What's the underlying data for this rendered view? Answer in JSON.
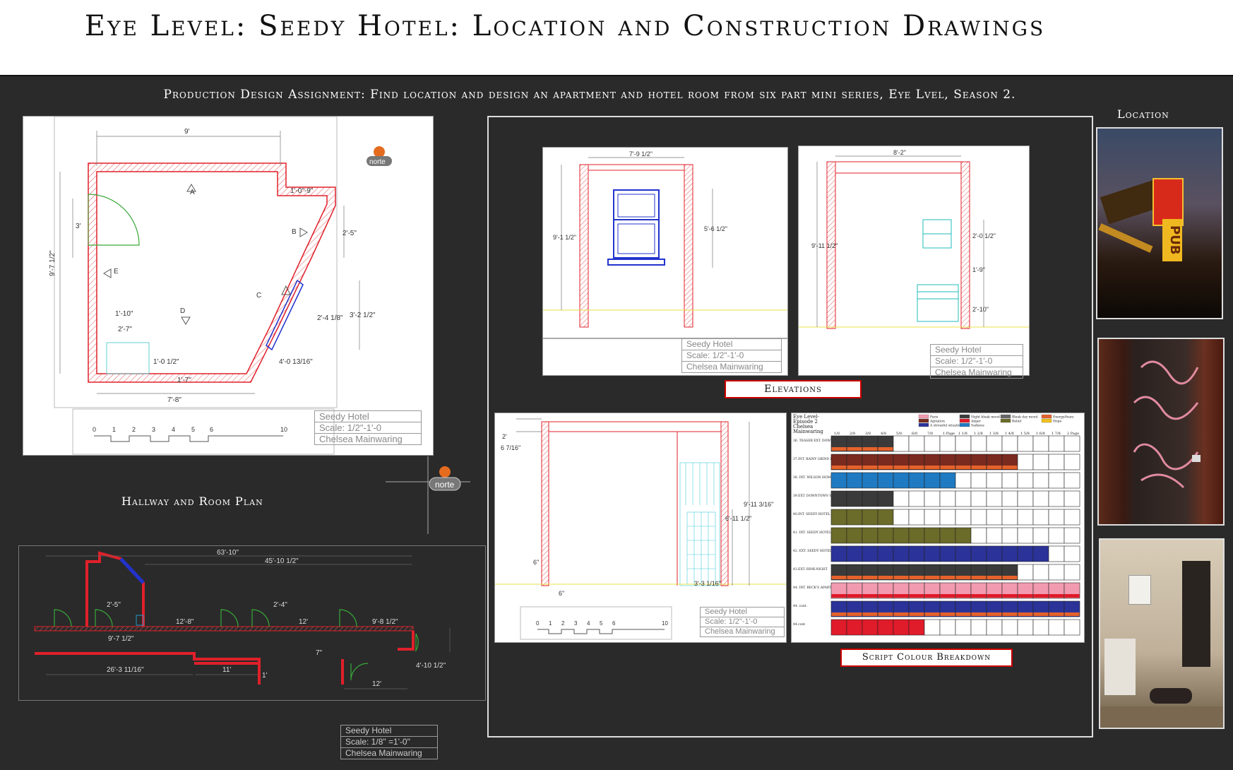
{
  "page": {
    "title": "Eye Level: Seedy Hotel: Location and Construction Drawings",
    "subtitle": "Production Design Assignment:  Find location and design an apartment and hotel room from six part mini series, Eye Lvel, Season 2."
  },
  "room_plan": {
    "dims": {
      "top": "9'",
      "notch": "1'-0\"-9\"",
      "left_wall": "3'",
      "right_upper": "2'-5\"",
      "total_h": "9'-7 1/2\"",
      "diag": "2'-4 1/8\"",
      "right_mid": "3'-2 1/2\"",
      "d1": "1'-10\"",
      "d2": "2'-7\"",
      "d3": "1'-0 1/2\"",
      "d4": "4'-0 13/16\"",
      "d5": "1'-7\"",
      "bottom": "7'-8\""
    },
    "markers": {
      "a": "A",
      "b": "B",
      "c": "C",
      "d": "D",
      "e": "E"
    },
    "scale_ticks": [
      "0",
      "1",
      "2",
      "3",
      "4",
      "5",
      "6",
      "10"
    ],
    "title_block": {
      "name": "Seedy Hotel",
      "scale": "Scale: 1/2\"-1'-0",
      "author": "Chelsea Mainwaring"
    }
  },
  "logo": {
    "text": "norte"
  },
  "hallway": {
    "label": "Hallway and Room Plan",
    "dims": [
      "63'-10\"",
      "45'-10 1/2\"",
      "2'-5\"",
      "9'-7 1/2\"",
      "12'-8\"",
      "2'-4\"",
      "12'",
      "9'-8 1/2\"",
      "26'-3 11/16\"",
      "11'",
      "1'",
      "7\"",
      "12'",
      "4'-10 1/2\""
    ],
    "title_block": {
      "name": "Seedy Hotel",
      "scale": "Scale: 1/8\" =1'-0\"",
      "author": "Chelsea Mainwaring"
    }
  },
  "elevations": {
    "label": "Elevations",
    "elev1": {
      "dims": [
        "7'-9 1/2\"",
        "9'-1 1/2\"",
        "5'-6 1/2\""
      ],
      "title_block": {
        "name": "Seedy Hotel",
        "scale": "Scale: 1/2\"-1'-0",
        "author": "Chelsea Mainwaring"
      }
    },
    "elev2": {
      "dims": [
        "8'-2\"",
        "9'-11 1/2\"",
        "2'-0 1/2\"",
        "1'-9\"",
        "2'-10\""
      ],
      "title_block": {
        "name": "Seedy Hotel",
        "scale": "Scale: 1/2\"-1'-0",
        "author": "Chelsea Mainwaring"
      }
    },
    "elev3": {
      "dims": [
        "2'",
        "6 7/16\"",
        "6\"",
        "9'-11 3/16\"",
        "6'-11 1/2\"",
        "3'-3 1/16\"",
        "6\""
      ],
      "scale_ticks": [
        "0",
        "1",
        "2",
        "3",
        "4",
        "5",
        "6",
        "10"
      ],
      "title_block": {
        "name": "Seedy Hotel",
        "scale": "Scale: 1/2\"-1'-0",
        "author": "Chelsea Mainwaring"
      }
    }
  },
  "breakdown": {
    "label": "Script Colour Breakdown",
    "header": "Eye Level- Episode 2 Chelsea Mainwaring",
    "legend": [
      {
        "label": "Paris",
        "color": "#f29ab0"
      },
      {
        "label": "Night bleak mood",
        "color": "#3a3a3a"
      },
      {
        "label": "Bleak day mood",
        "color": "#666666"
      },
      {
        "label": "Energy/fears",
        "color": "#e5622b"
      },
      {
        "label": "Agitation",
        "color": "#7a2a1f"
      },
      {
        "label": "Anger",
        "color": "#e01b2a"
      },
      {
        "label": "Relief",
        "color": "#6b6b2a"
      },
      {
        "label": "Hope",
        "color": "#f1c21b"
      },
      {
        "label": "A stressful situation",
        "color": "#2b3399"
      },
      {
        "label": "Sadness",
        "color": "#1f7ac2"
      }
    ],
    "columns": [
      "1/8",
      "2/8",
      "3/8",
      "4/8",
      "5/8",
      "6/8",
      "7/8",
      "1 Page",
      "1 1/8",
      "1 2/8",
      "1 3/8",
      "1 4/8",
      "1 5/8",
      "1 6/8",
      "1 7/8",
      "2 Page"
    ],
    "rows": [
      {
        "label": "36. TEASER EXT. DOWNTOWN VANCOUVER-NIGHT",
        "fill": 4,
        "color": "#3a3a3a",
        "band": "#e5622b"
      },
      {
        "label": "37.INT. RAINY GRIND PARTY-NIGHT",
        "fill": 12,
        "color": "#7a2a1f",
        "band": "#e5622b"
      },
      {
        "label": "38. INT. WILSON HOME KITCHEN-NIGHT",
        "fill": 8,
        "color": "#1f7ac2",
        "band": ""
      },
      {
        "label": "39.EXT. DOWNTOWN VANCOUVER-NIGHT",
        "fill": 4,
        "color": "#3a3a3a",
        "band": ""
      },
      {
        "label": "40.INT. SEEDY HOTEL HALLWAY/WASHROOM NIGHT",
        "fill": 4,
        "color": "#6b6b2a",
        "band": ""
      },
      {
        "label": "41. INT. SEEDY HOTEL RM TO HALLWAY-NIGHT",
        "fill": 9,
        "color": "#6b6b2a",
        "band": ""
      },
      {
        "label": "42. EXT. SEEDY HOTEL TO ALLEYWAY-NIGHT",
        "fill": 14,
        "color": "#2b3399",
        "band": ""
      },
      {
        "label": "43.EXT. RINK-NIGHT",
        "fill": 12,
        "color": "#3a3a3a",
        "band": "#e5622b"
      },
      {
        "label": "44. INT. BECK'S APARTMENT-NIGHT",
        "fill": 16,
        "color": "#f29ab0",
        "band": "#e01b2a"
      },
      {
        "label": "44. cont.",
        "fill": 16,
        "color": "#2b3399",
        "band": "#e5622b"
      },
      {
        "label": "44.cont",
        "fill": 6,
        "color": "#e01b2a",
        "band": ""
      }
    ]
  },
  "location": {
    "label": "Location",
    "sign_text": "PUB"
  }
}
